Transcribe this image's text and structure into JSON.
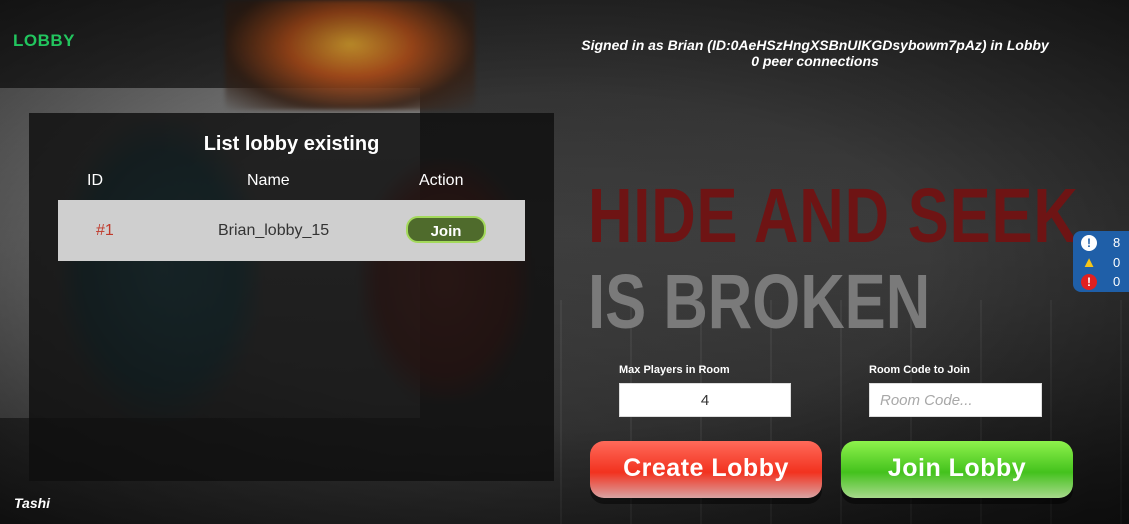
{
  "header": {
    "lobby_title": "LOBBY",
    "signed_in": "Signed in as Brian (ID:0AeHSzHngXSBnUIKGDsybowm7pAz) in Lobby",
    "peer_connections": "0 peer connections"
  },
  "game_title": {
    "line1": "HIDE AND SEEK",
    "line2": "IS BROKEN"
  },
  "lobby_list": {
    "title": "List lobby existing",
    "columns": [
      "ID",
      "Name",
      "Action"
    ],
    "rows": [
      {
        "id": "#1",
        "name": "Brian_lobby_15",
        "action": "Join"
      }
    ]
  },
  "diagnostics": {
    "info_count": "8",
    "warning_count": "0",
    "error_count": "0",
    "info_icon": "info-icon",
    "warning_icon": "warning-icon",
    "error_icon": "error-icon"
  },
  "form": {
    "max_players_label": "Max Players in Room",
    "max_players_value": "4",
    "room_code_label": "Room Code to Join",
    "room_code_placeholder": "Room Code..."
  },
  "buttons": {
    "create_lobby": "Create Lobby",
    "join_lobby": "Join Lobby"
  },
  "footer": {
    "player_name": "Tashi"
  },
  "colors": {
    "lobby_green": "#22c55e",
    "create_red": "#f2321f",
    "join_green": "#44c21d",
    "row_bg": "#cfcfcf",
    "id_red": "#c0392b"
  }
}
